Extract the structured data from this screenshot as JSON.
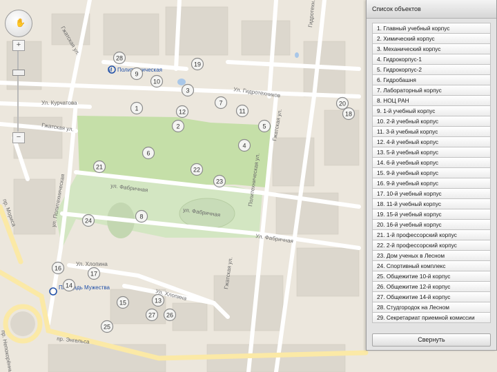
{
  "colors": {
    "land": "#ece7dd",
    "park": "#c5dfa8",
    "road": "#ffffff",
    "main_road": "#fbe9a6",
    "building": "#d9d5cc",
    "water": "#a9c7e8",
    "metro": "#1f4fa8"
  },
  "navigation": {
    "zoom_in_label": "+",
    "zoom_out_label": "−",
    "zoom_level_fraction": 0.25
  },
  "streets": {
    "s1": "Ул. Гидротехников",
    "s2": "Ул. Курчатова",
    "s3": "Гжатская ул.",
    "s4": "Гжатская ул.",
    "s5": "ул. Фабричная",
    "s6": "ул. Фабричная",
    "s7": "Ул. Фабричная",
    "s8": "Ул. Хлопина",
    "s9": "Ул. Хлопина",
    "s10": "пр. Энгельса",
    "s11": "пр. Непокорённых",
    "s12": "Гжатская ул.",
    "s13": "ул. Политехническая",
    "s14": "Политехническая ул.",
    "s15": "Гжатская ул.",
    "s16": "Гидротехн.",
    "s17": "пр. Мориса"
  },
  "places": {
    "metro_1": "Политехническая",
    "metro_2": "Площадь Мужества"
  },
  "markers": [
    "1",
    "2",
    "3",
    "4",
    "5",
    "6",
    "7",
    "8",
    "9",
    "10",
    "11",
    "12",
    "13",
    "14",
    "15",
    "16",
    "17",
    "19",
    "20",
    "21",
    "22",
    "23",
    "24",
    "25",
    "26",
    "27",
    "28",
    "18"
  ],
  "panel": {
    "title": "Список объектов",
    "items": [
      "1. Главный учебный корпус",
      "2. Химический корпус",
      "3. Механический корпус",
      "4. Гидрокорпус-1",
      "5. Гидрокорпус-2",
      "6. Гидробашня",
      "7. Лабораторный корпус",
      "8. НОЦ РАН",
      "9. 1-й учебный корпус",
      "10. 2-й учебный корпус",
      "11. 3-й учебный корпус",
      "12. 4-й учебный корпус",
      "13. 5-й учебный корпус",
      "14. 6-й учебный корпус",
      "15. 9-й учебный корпус",
      "16. 9-й учебный корпус",
      "17. 10-й учебный корпус",
      "18. 11-й учебный корпус",
      "19. 15-й учебный корпус",
      "20. 16-й учебный корпус",
      "21. 1-й профессорский корпус",
      "22. 2-й профессорский корпус",
      "23. Дом ученых в Лесном",
      "24. Спортивный комплекс",
      "25. Общежитие 10-й корпус",
      "26. Общежитие 12-й корпус",
      "27. Общежитие 14-й корпус",
      "28. Студгородок на Лесном",
      "29. Секретариат приемной комиссии"
    ],
    "collapse_label": "Свернуть"
  }
}
